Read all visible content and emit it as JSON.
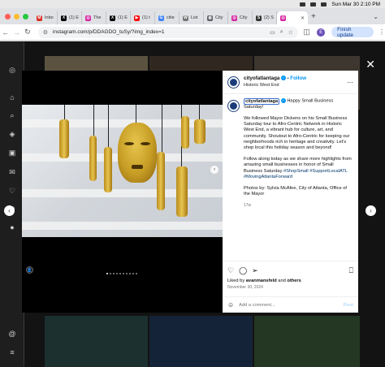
{
  "menubar": {
    "datetime": "Sun Mar 30  2:10 PM"
  },
  "tabs": [
    {
      "title": "Inbo",
      "icon": "gmail-icon",
      "color": "#d93025",
      "glyph": "M"
    },
    {
      "title": "(1) E",
      "icon": "x-icon",
      "color": "#000000",
      "glyph": "X"
    },
    {
      "title": "The",
      "icon": "instagram-icon",
      "color": "#d6249f",
      "glyph": "◎"
    },
    {
      "title": "(1) E",
      "icon": "x-icon",
      "color": "#000000",
      "glyph": "X"
    },
    {
      "title": "(1) t",
      "icon": "youtube-icon",
      "color": "#ff0000",
      "glyph": "▶"
    },
    {
      "title": "citie",
      "icon": "google-icon",
      "color": "#4285f4",
      "glyph": "G"
    },
    {
      "title": "List",
      "icon": "wikipedia-icon",
      "color": "#777777",
      "glyph": "W"
    },
    {
      "title": "City",
      "icon": "globe-icon",
      "color": "#5f6368",
      "glyph": "◍"
    },
    {
      "title": "City",
      "icon": "instagram-icon",
      "color": "#d6249f",
      "glyph": "◎"
    },
    {
      "title": "(2) S",
      "icon": "site-icon",
      "color": "#333333",
      "glyph": "S"
    },
    {
      "title": "",
      "icon": "instagram-icon",
      "color": "#d6249f",
      "glyph": "◎",
      "active": true
    }
  ],
  "address": {
    "url": "instagram.com/p/DDAGDO_tuSy/?img_index=1",
    "profile_letter": "E",
    "finish_update": "Finish update"
  },
  "post": {
    "username": "cityofatlantaga",
    "follow": "Follow",
    "location": "Historic West End",
    "caption_user": "cityofatlantaga",
    "p1": "Happy Small Business Saturday!",
    "p2": "We followed Mayor Dickens on his Small Business Saturday tour to Afro-Centric Network in Historic West End, a vibrant hub for culture, art, and community. Shoutout to Afro-Centric for keeping our neighborhoods rich in heritage and creativity. Let's shop local this holiday season and beyond!",
    "p3": "Follow along today as we share more highlights from amazing small businesses in honor of Small Business Saturday",
    "hashtags": "#ShopSmall #SupportLocalATL #MovingAtlantaForward",
    "p4": "Photos by: Sylvia McAfee, City of Atlanta, Office of the Mayor",
    "age": "17w",
    "liked_by_prefix": "Liked by ",
    "liked_by_user": "avanmansfeld",
    "liked_by_mid": " and ",
    "liked_by_others": "others",
    "date": "November 30, 2024",
    "comment_placeholder": "Add a comment...",
    "post_label": "Post"
  },
  "colors": {
    "accent": "#0095f6",
    "brand_avatar": "#1a3d7a",
    "finish_bg": "#d3e3fd"
  }
}
